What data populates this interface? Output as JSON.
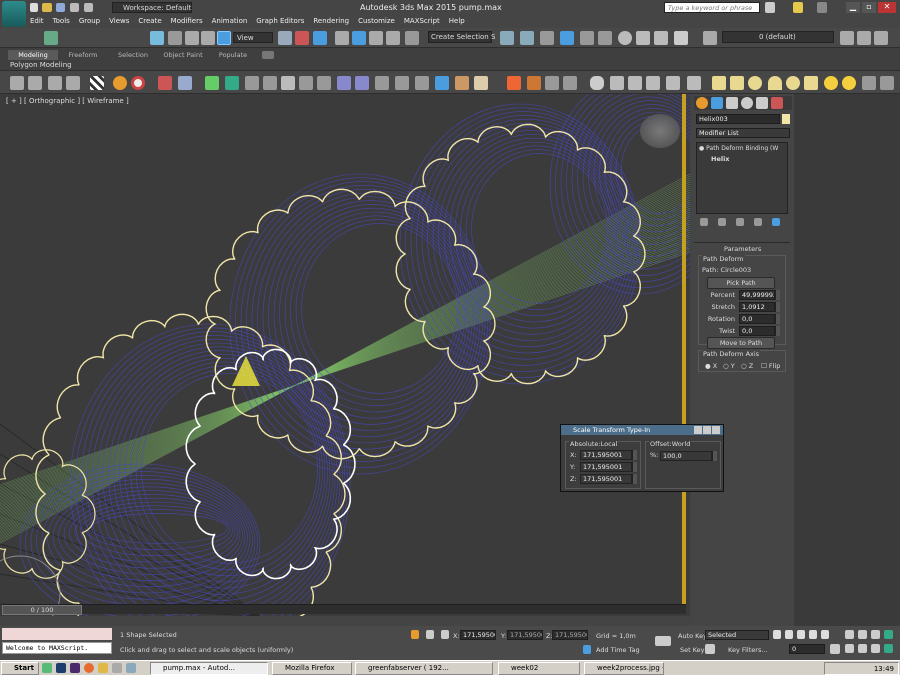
{
  "app": {
    "title": "Autodesk 3ds Max 2015    pump.max",
    "search_placeholder": "Type a keyword or phrase",
    "workspace": "Workspace: Default"
  },
  "menu": [
    "Edit",
    "Tools",
    "Group",
    "Views",
    "Create",
    "Modifiers",
    "Animation",
    "Graph Editors",
    "Rendering",
    "Customize",
    "MAXScript",
    "Help"
  ],
  "toolbar": {
    "view_dropdown": "View",
    "selection_set": "Create Selection S",
    "layer": "0 (default)"
  },
  "ribbon": {
    "tabs": [
      "Modeling",
      "Freeform",
      "Selection",
      "Object Paint",
      "Populate"
    ],
    "sublabel": "Polygon Modeling"
  },
  "viewport": {
    "label": "[ + ] [ Orthographic ] [ Wireframe ]",
    "timeline": "0 / 100"
  },
  "command_panel": {
    "object_name": "Helix003",
    "modifier_list": "Modifier List",
    "stack": [
      "Path Deform Binding (W",
      "Helix"
    ],
    "parameters_title": "Parameters",
    "path_deform_group": "Path Deform",
    "path_label": "Path: Circle003",
    "pick_path": "Pick Path",
    "fields": [
      {
        "label": "Percent",
        "value": "49,999992"
      },
      {
        "label": "Stretch",
        "value": "1,0912"
      },
      {
        "label": "Rotation",
        "value": "0,0"
      },
      {
        "label": "Twist",
        "value": "0,0"
      }
    ],
    "move_to_path": "Move to Path",
    "axis_group": "Path Deform Axis",
    "axis": [
      "X",
      "Y",
      "Z"
    ],
    "flip": "Flip"
  },
  "dialog": {
    "title": "Scale Transform Type-In",
    "absolute_group": "Absolute:Local",
    "offset_group": "Offset:World",
    "absolute": [
      {
        "axis": "X:",
        "value": "171,595001"
      },
      {
        "axis": "Y:",
        "value": "171,595001"
      },
      {
        "axis": "Z:",
        "value": "171,595001"
      }
    ],
    "offset": {
      "axis": "%:",
      "value": "100,0"
    }
  },
  "status": {
    "maxscript": "Welcome to MAXScript.",
    "selected": "1 Shape Selected",
    "prompt": "Click and drag to select and scale objects (uniformly)",
    "x": "171,59500",
    "y": "171,59500",
    "z": "171,59500",
    "grid": "Grid = 1,0m",
    "add_time_tag": "Add Time Tag",
    "auto_key": "Auto Key",
    "set_key": "Set Key",
    "selected_dropdown": "Selected",
    "key_filters": "Key Filters...",
    "frame": "0"
  },
  "taskbar": {
    "start": "Start",
    "items": [
      "pump.max - Autod...",
      "Mozilla Firefox",
      "greenfabserver ( 192...",
      "week02",
      "week2process.jpg - ..."
    ],
    "clock": "13:49"
  },
  "colors": {
    "helix": "#f0e6a8",
    "mesh": "#4a48c8",
    "green": "#7fbf66"
  }
}
